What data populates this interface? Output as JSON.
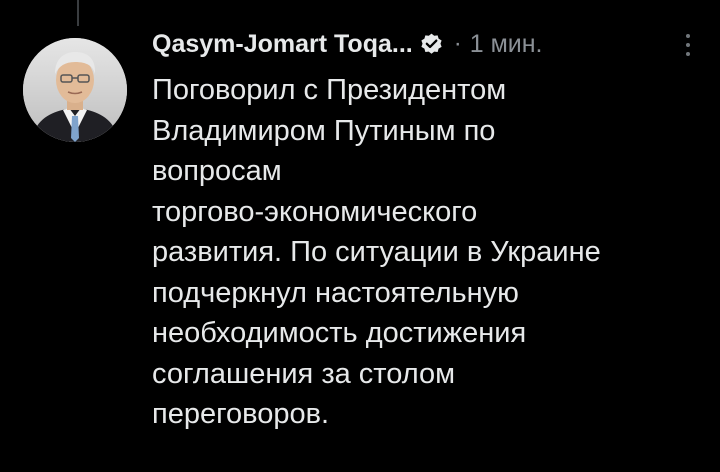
{
  "tweet": {
    "author_name": "Qasym-Jomart Toqa...",
    "verified_icon": "verified-badge-icon",
    "separator": "·",
    "timestamp": "1 мин.",
    "more_icon": "more-options-icon",
    "lines": [
      "Поговорил с Президентом",
      "Владимиром Путиным по",
      "вопросам",
      "торгово-экономического",
      "развития. По ситуации в Украине",
      "подчеркнул настоятельную",
      "необходимость достижения",
      "соглашения за столом",
      "переговоров."
    ]
  },
  "colors": {
    "background": "#000000",
    "text": "#e7e9ea",
    "secondary_text": "#8b9096",
    "thread_line": "#3a3d40"
  }
}
